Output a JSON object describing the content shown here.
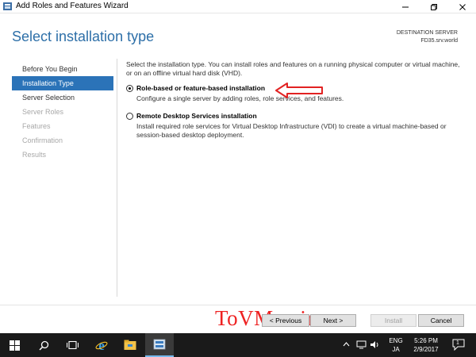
{
  "window": {
    "title": "Add Roles and Features Wizard",
    "minimize_icon": "minimize-icon",
    "maximize_icon": "maximize-icon",
    "close_icon": "close-icon"
  },
  "header": {
    "page_title": "Select installation type",
    "destination_label": "DESTINATION SERVER",
    "destination_server": "FD35.srv.world"
  },
  "nav": {
    "items": [
      {
        "label": "Before You Begin",
        "state": "normal"
      },
      {
        "label": "Installation Type",
        "state": "active"
      },
      {
        "label": "Server Selection",
        "state": "normal"
      },
      {
        "label": "Server Roles",
        "state": "disabled"
      },
      {
        "label": "Features",
        "state": "disabled"
      },
      {
        "label": "Confirmation",
        "state": "disabled"
      },
      {
        "label": "Results",
        "state": "disabled"
      }
    ]
  },
  "main": {
    "description": "Select the installation type. You can install roles and features on a running physical computer or virtual machine, or on an offline virtual hard disk (VHD).",
    "options": [
      {
        "title": "Role-based or feature-based installation",
        "description": "Configure a single server by adding roles, role services, and features.",
        "selected": true
      },
      {
        "title": "Remote Desktop Services installation",
        "description": "Install required role services for Virtual Desktop Infrastructure (VDI) to create a virtual machine-based or session-based desktop deployment.",
        "selected": false
      }
    ]
  },
  "buttons": {
    "previous": "< Previous",
    "next": "Next >",
    "install": "Install",
    "cancel": "Cancel"
  },
  "watermark": "ToVMan.ir",
  "taskbar": {
    "icons": [
      "windows-start-icon",
      "search-icon",
      "task-view-icon",
      "internet-explorer-icon",
      "file-explorer-icon",
      "server-manager-icon"
    ],
    "language_top": "ENG",
    "language_bottom": "JA",
    "time": "5:26 PM",
    "date": "2/9/2017",
    "notification_count": "1"
  },
  "colors": {
    "accent": "#2b73b8",
    "title_blue": "#2d6fa8",
    "annotation_red": "#e22222",
    "taskbar": "#1a1a1a"
  }
}
